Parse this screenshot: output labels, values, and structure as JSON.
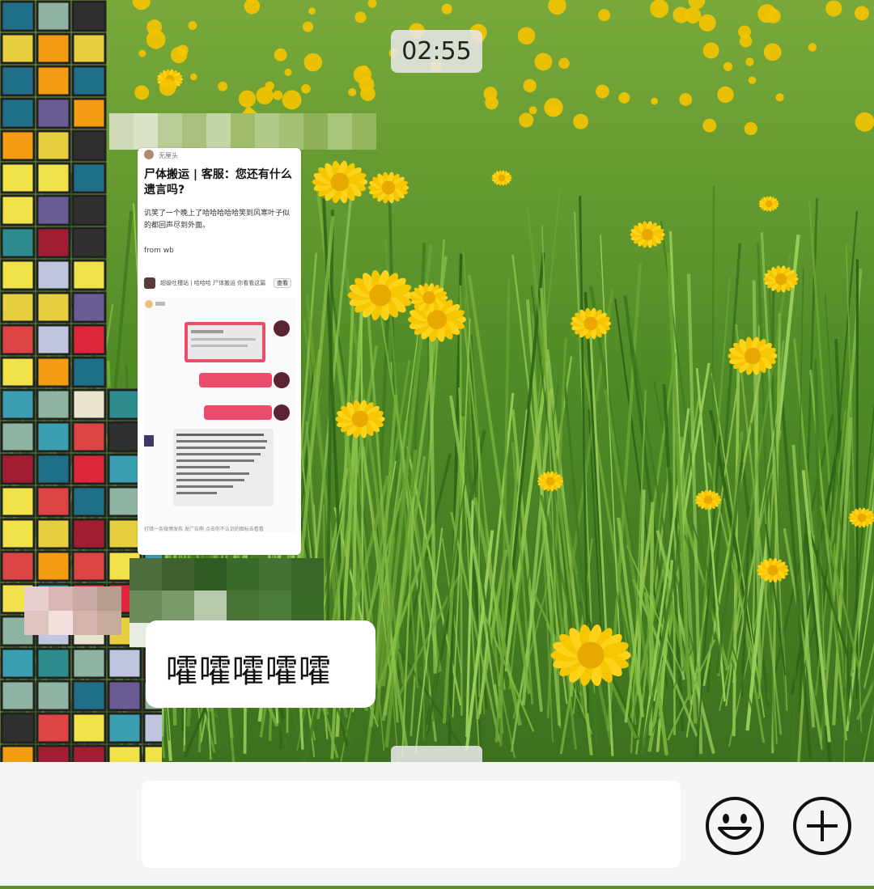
{
  "chat": {
    "timestamp_top": "02:55",
    "timestamp_bottom_partial": "",
    "shared_card": {
      "author": "无厘头",
      "title": "尸体搬运 | 客服：您还有什么遗言吗?",
      "body": "讥笑了一个晚上了哈哈哈哈哈笑到风寒叶子似的都回声尽到外面。",
      "source": "from wb",
      "share_line": "超级吐槽站 | 哈哈哈 尸体搬运 你看看这篇...",
      "share_button": "查看",
      "footer": "打错一条微博发布 发广告啊 点击你不认识的图标去看看"
    },
    "message_text": "嚯嚯嚯嚯嚯"
  },
  "input": {
    "value": "",
    "emoji_icon": "smiley-icon",
    "plus_icon": "plus-circle-icon"
  },
  "colors": {
    "grass": "#5f8f2c",
    "dandelion": "#f5c400",
    "bubble": "#ffffff",
    "bar": "#f5f5f5"
  }
}
